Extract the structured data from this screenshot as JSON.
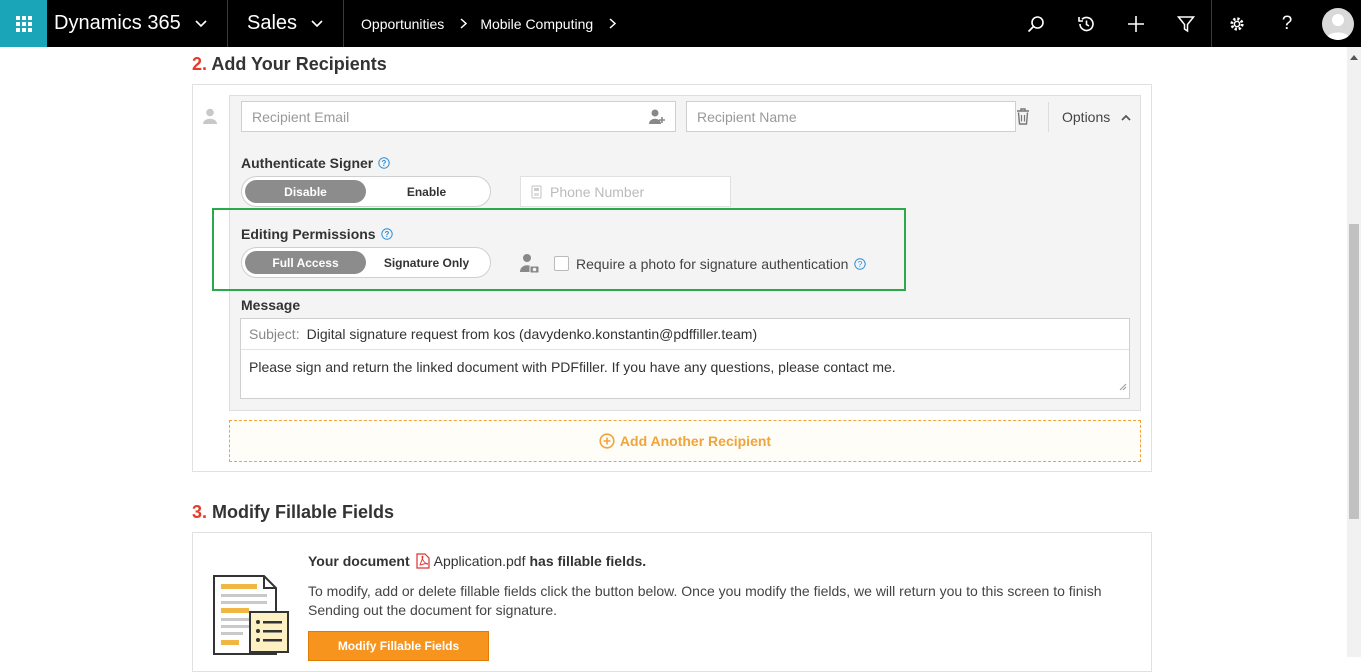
{
  "topbar": {
    "app_title": "Dynamics 365",
    "module": "Sales",
    "breadcrumb": [
      "Opportunities",
      "Mobile Computing"
    ]
  },
  "section2": {
    "number": "2.",
    "title": "Add Your Recipients",
    "recipient_email_placeholder": "Recipient Email",
    "recipient_name_placeholder": "Recipient Name",
    "options_label": "Options",
    "authenticate_label": "Authenticate Signer",
    "auth_options": [
      "Disable",
      "Enable"
    ],
    "phone_placeholder": "Phone Number",
    "editing_label": "Editing Permissions",
    "editing_options": [
      "Full Access",
      "Signature Only"
    ],
    "photo_label": "Require a photo for signature authentication",
    "message_label": "Message",
    "subject_label": "Subject:",
    "subject_value": "Digital signature request from kos (davydenko.konstantin@pdffiller.team)",
    "body_value": "Please sign and return the linked document with PDFfiller. If you have any questions, please contact me.",
    "add_another": "Add Another Recipient"
  },
  "section3": {
    "number": "3.",
    "title": "Modify Fillable Fields",
    "your_document": "Your document",
    "filename": "Application.pdf",
    "has_fields": "has fillable fields.",
    "description": "To modify, add or delete fillable fields click the button below. Once you modify the fields, we will return you to this screen to finish Sending out the document for signature.",
    "button_label": "Modify Fillable Fields"
  },
  "colors": {
    "accent_teal": "#1aa5b8",
    "section_number_red": "#e33b2e",
    "highlight_green": "#2aa84a",
    "orange": "#f7941d"
  }
}
